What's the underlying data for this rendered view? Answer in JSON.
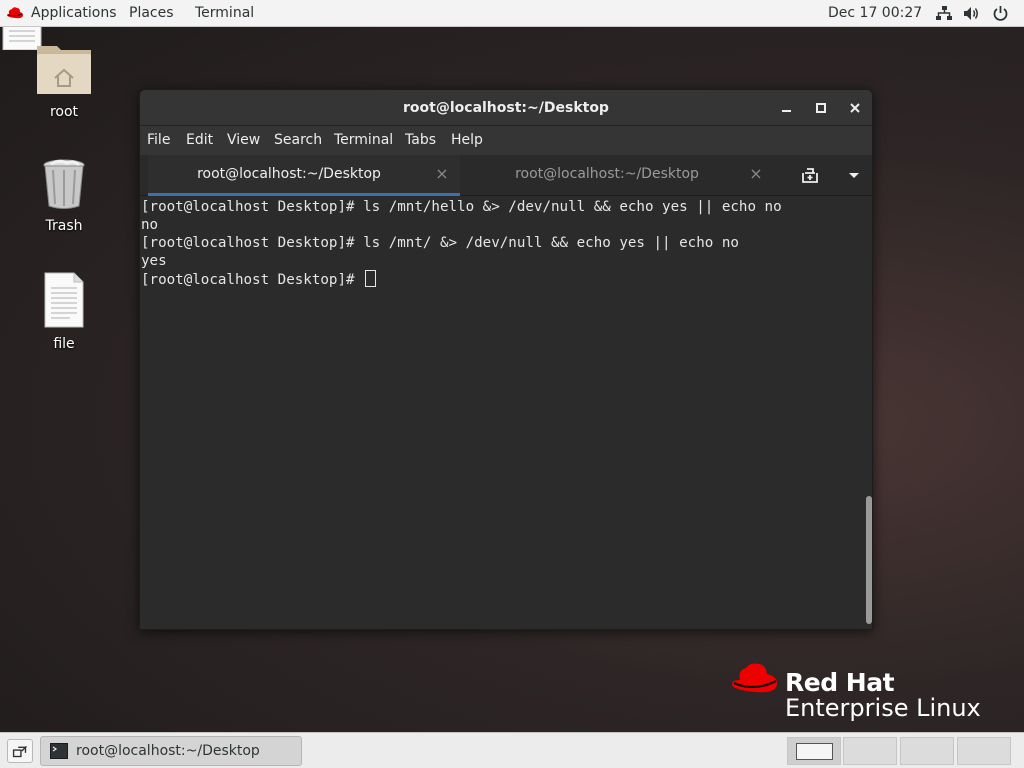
{
  "topbar": {
    "applications": "Applications",
    "places": "Places",
    "terminal": "Terminal",
    "clock": "Dec 17  00:27",
    "icons": [
      "redhat-icon",
      "network-icon",
      "volume-icon",
      "power-icon"
    ]
  },
  "desktop": {
    "icons": [
      {
        "label": "root",
        "icon": "home-folder-icon"
      },
      {
        "label": "Trash",
        "icon": "trash-icon"
      },
      {
        "label": "file",
        "icon": "document-icon"
      }
    ]
  },
  "window": {
    "title": "root@localhost:~/Desktop",
    "menu": [
      "File",
      "Edit",
      "View",
      "Search",
      "Terminal",
      "Tabs",
      "Help"
    ],
    "tabs": [
      {
        "label": "root@localhost:~/Desktop",
        "active": true
      },
      {
        "label": "root@localhost:~/Desktop",
        "active": false
      }
    ],
    "lines": [
      "[root@localhost Desktop]# ls /mnt/hello &> /dev/null && echo yes || echo no",
      "no",
      "[root@localhost Desktop]# ls /mnt/ &> /dev/null && echo yes || echo no",
      "yes",
      "[root@localhost Desktop]# "
    ]
  },
  "branding": {
    "line1": "Red Hat",
    "line2": "Enterprise Linux",
    "color": "#ee0000"
  },
  "taskbar": {
    "task_label": "root@localhost:~/Desktop",
    "workspaces": 4,
    "active_workspace": 1
  }
}
